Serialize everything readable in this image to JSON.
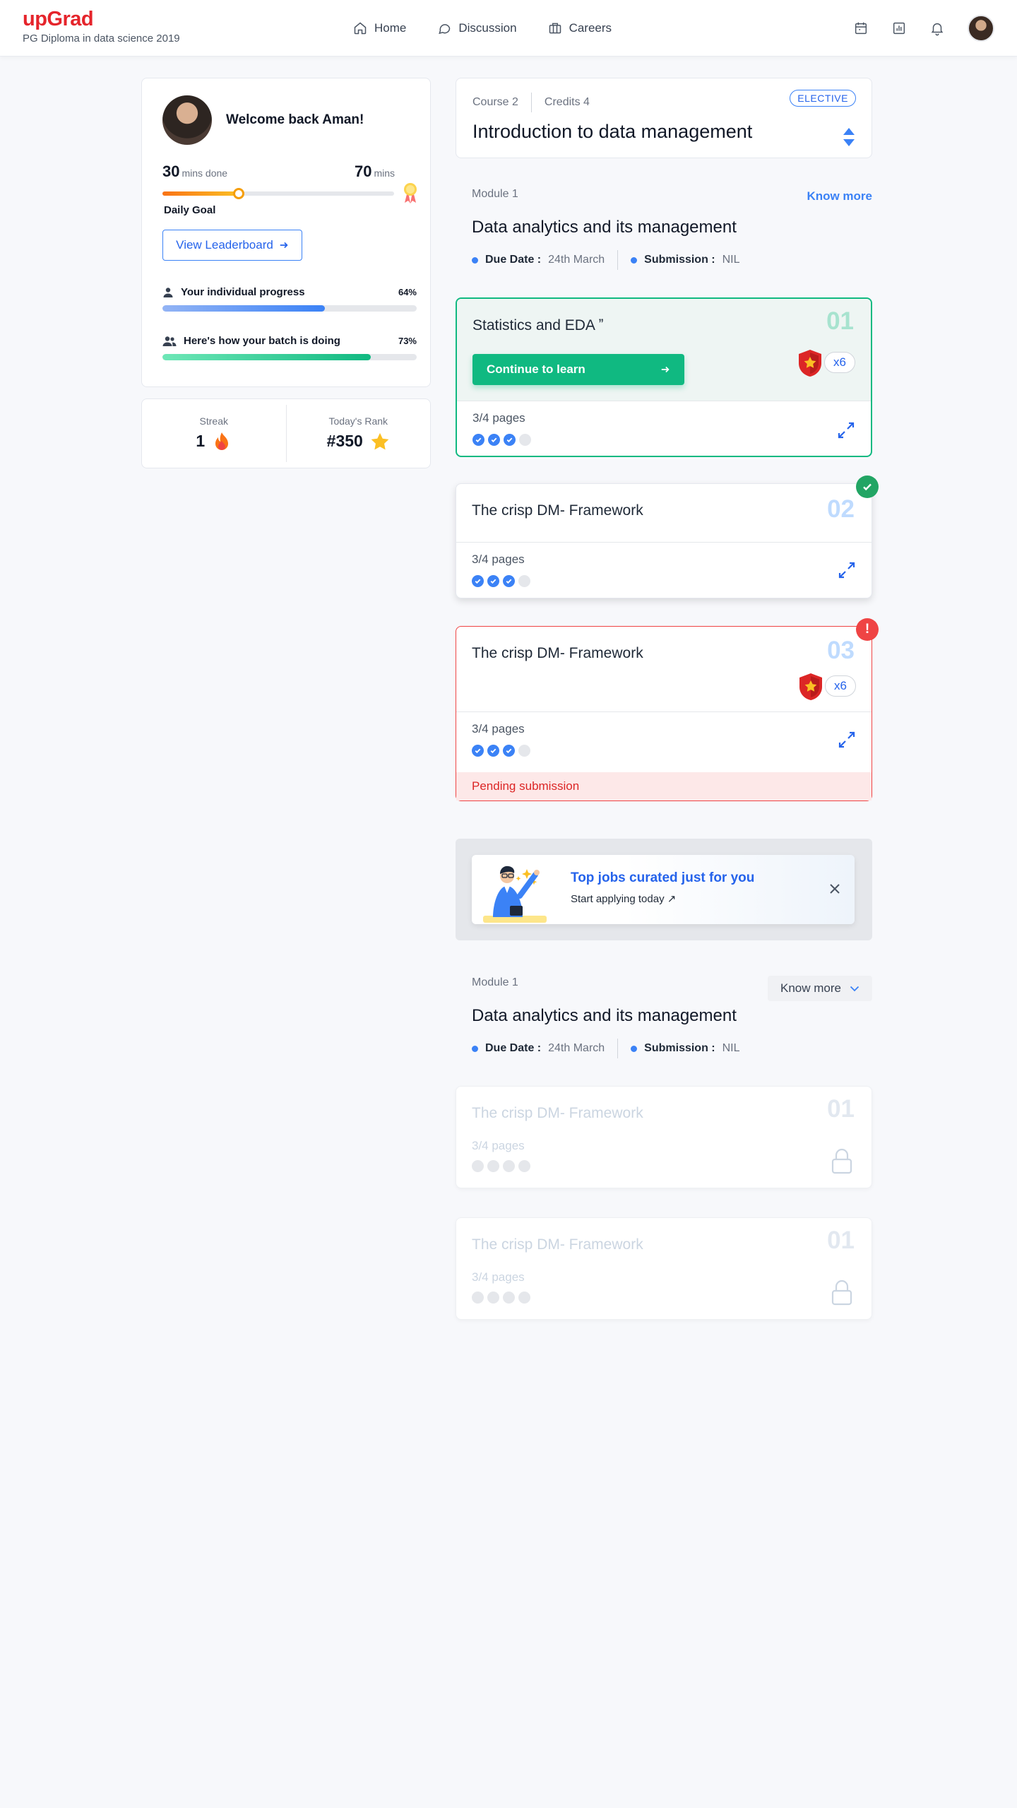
{
  "header": {
    "brand": "upGrad",
    "program": "PG Diploma in data science 2019",
    "nav": [
      {
        "label": "Home",
        "icon": "home-icon"
      },
      {
        "label": "Discussion",
        "icon": "chat-icon"
      },
      {
        "label": "Careers",
        "icon": "briefcase-icon"
      }
    ]
  },
  "welcome": {
    "greeting": "Welcome back Aman!",
    "mins_done_value": "30",
    "mins_done_unit": "mins done",
    "mins_goal_value": "70",
    "mins_goal_unit": "mins",
    "daily_goal_progress": 0.33,
    "daily_goal_label": "Daily Goal",
    "leaderboard_button": "View Leaderboard",
    "individual_label": "Your individual progress",
    "individual_pct": "64%",
    "individual_value": 0.64,
    "batch_label": "Here's how your batch is doing",
    "batch_pct": "73%",
    "batch_value": 0.82
  },
  "stats": {
    "streak_label": "Streak",
    "streak_value": "1",
    "rank_label": "Today's Rank",
    "rank_value": "#350"
  },
  "course": {
    "course_no": "Course 2",
    "credits": "Credits 4",
    "tag": "ELECTIVE",
    "title": "Introduction to data management"
  },
  "module1": {
    "label": "Module 1",
    "know_more": "Know more",
    "title": "Data analytics and its management",
    "due_label": "Due Date :",
    "due_value": "24th March",
    "submission_label": "Submission :",
    "submission_value": "NIL"
  },
  "lessons": [
    {
      "title": "Statistics and EDA ˮ",
      "num": "01",
      "button": "Continue to learn",
      "badge": "x6",
      "pages": "3/4 pages",
      "done": 3,
      "total": 4
    },
    {
      "title": "The crisp DM- Framework",
      "num": "02",
      "pages": "3/4 pages",
      "done": 3,
      "total": 4
    },
    {
      "title": "The crisp DM- Framework",
      "num": "03",
      "badge": "x6",
      "pages": "3/4 pages",
      "done": 3,
      "total": 4,
      "status": "Pending submission"
    }
  ],
  "jobs": {
    "title": "Top jobs curated just for you",
    "subtitle": "Start applying today ↗"
  },
  "module2": {
    "label": "Module 1",
    "know_more": "Know more",
    "title": "Data analytics and its management",
    "due_label": "Due Date :",
    "due_value": "24th March",
    "submission_label": "Submission :",
    "submission_value": "NIL"
  },
  "locked_lessons": [
    {
      "title": "The crisp DM- Framework",
      "num": "01",
      "pages": "3/4 pages"
    },
    {
      "title": "The crisp DM- Framework",
      "num": "01",
      "pages": "3/4 pages"
    }
  ],
  "colors": {
    "brand": "#e5242b",
    "accent": "#3b82f6",
    "success": "#10b981",
    "danger": "#ef4444"
  }
}
